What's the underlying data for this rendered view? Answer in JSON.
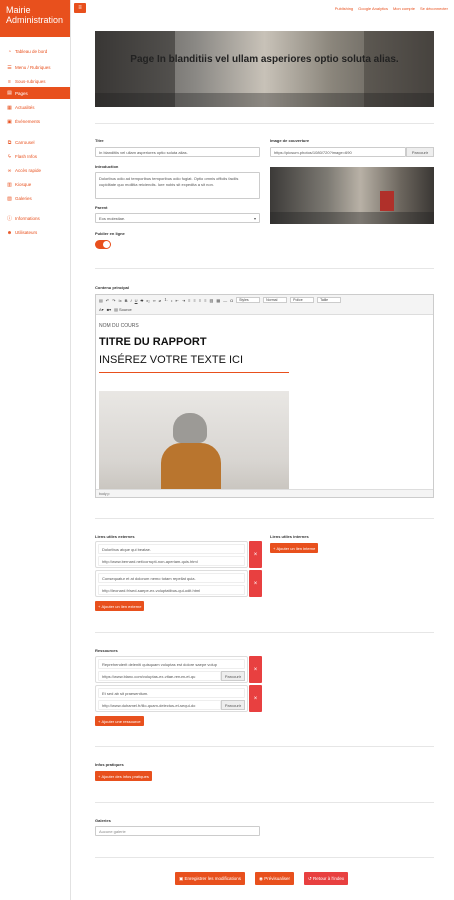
{
  "sidebar": {
    "brand": "Mairie Administration",
    "items": [
      {
        "label": "Tableau de bord",
        "icon": "dashboard-icon"
      },
      {
        "label": "Menu / Rubriques",
        "icon": "menu-icon"
      },
      {
        "label": "Sous-rubriques",
        "icon": "list-icon"
      },
      {
        "label": "Pages",
        "icon": "file-icon",
        "active": true
      },
      {
        "label": "Actualités",
        "icon": "newspaper-icon"
      },
      {
        "label": "Événements",
        "icon": "calendar-icon"
      },
      {
        "label": "Carrousel",
        "icon": "slides-icon"
      },
      {
        "label": "Flash Infos",
        "icon": "bolt-icon"
      },
      {
        "label": "Accès rapide",
        "icon": "link-icon"
      },
      {
        "label": "Kiosque",
        "icon": "book-icon"
      },
      {
        "label": "Galeries",
        "icon": "image-icon"
      },
      {
        "label": "Informations",
        "icon": "info-icon"
      },
      {
        "label": "Utilisateurs",
        "icon": "users-icon"
      }
    ]
  },
  "topbar": {
    "toggle_icon": "hamburger-icon",
    "links": [
      "Publishing",
      "Google Analytics",
      "Mon compte",
      "Se déconnecter"
    ]
  },
  "hero": {
    "title": "Page In blanditiis vel ullam asperiores optio soluta alias."
  },
  "form": {
    "title_label": "Titre",
    "title_value": "In blanditiis vel ullam asperiores optio soluta alias.",
    "cover_label": "Image de couverture",
    "cover_value": "https://picsum.photos/1080/720?image=690",
    "browse_label": "Parcourir",
    "intro_label": "Introduction",
    "intro_value": "Doloribus odio ad temporibus temporibus odio fugiat. Optio omnis officiis facilis cupiditate quo mollitia reiciendis. Iure nobis sit expedita a sit non.",
    "parent_label": "Parent",
    "parent_value": "Eos molestiae.",
    "publish_label": "Publier en ligne",
    "publish_on": true
  },
  "editor": {
    "label": "Contenu principal",
    "toolbar_selects": [
      "Styles",
      "Normal",
      "Police",
      "Taille"
    ],
    "cours": "NOM DU COURS",
    "titre": "TITRE DU RAPPORT",
    "texte": "INSÉREZ VOTRE TEXTE ICI",
    "status": "body  p"
  },
  "links": {
    "external_label": "Liens utiles externes",
    "internal_label": "Liens utiles internes",
    "external": [
      {
        "title": "Doloribus atque qui beatae.",
        "url": "http://www.bernard.net/corrupti-non-aperiam-quis.html"
      },
      {
        "title": "Consequatur et at dolorum nemo totam repellat quia.",
        "url": "http://leonard.fr/sed-saepe-ex-voluptatibus-qui-odit.html"
      }
    ],
    "add_external": "Ajouter un lien externe",
    "add_internal": "Ajouter un lien interne"
  },
  "resources": {
    "label": "Ressources",
    "items": [
      {
        "title": "Reprehenderit deleniti quisquam voluptas est dolore saepe volup",
        "url": "https://www.blanc.com/voluptas-ex-vitae-rerum-et-qu"
      },
      {
        "title": "Et sed ab sit praesentium.",
        "url": "http://www.duhamel.fr/illo-quam-delectus-et-sequi-do"
      }
    ],
    "browse_label": "Parcourir",
    "add": "Ajouter une ressource"
  },
  "infos": {
    "label": "Infos pratiques",
    "add": "Ajouter des infos pratiques"
  },
  "galleries": {
    "label": "Galeries",
    "placeholder": "Aucune galerie"
  },
  "footer": {
    "save": "Enregistrer les modifications",
    "preview": "Prévisualiser",
    "back": "Retour à l'index"
  },
  "colors": {
    "accent": "#e8501d",
    "danger": "#e84040"
  }
}
